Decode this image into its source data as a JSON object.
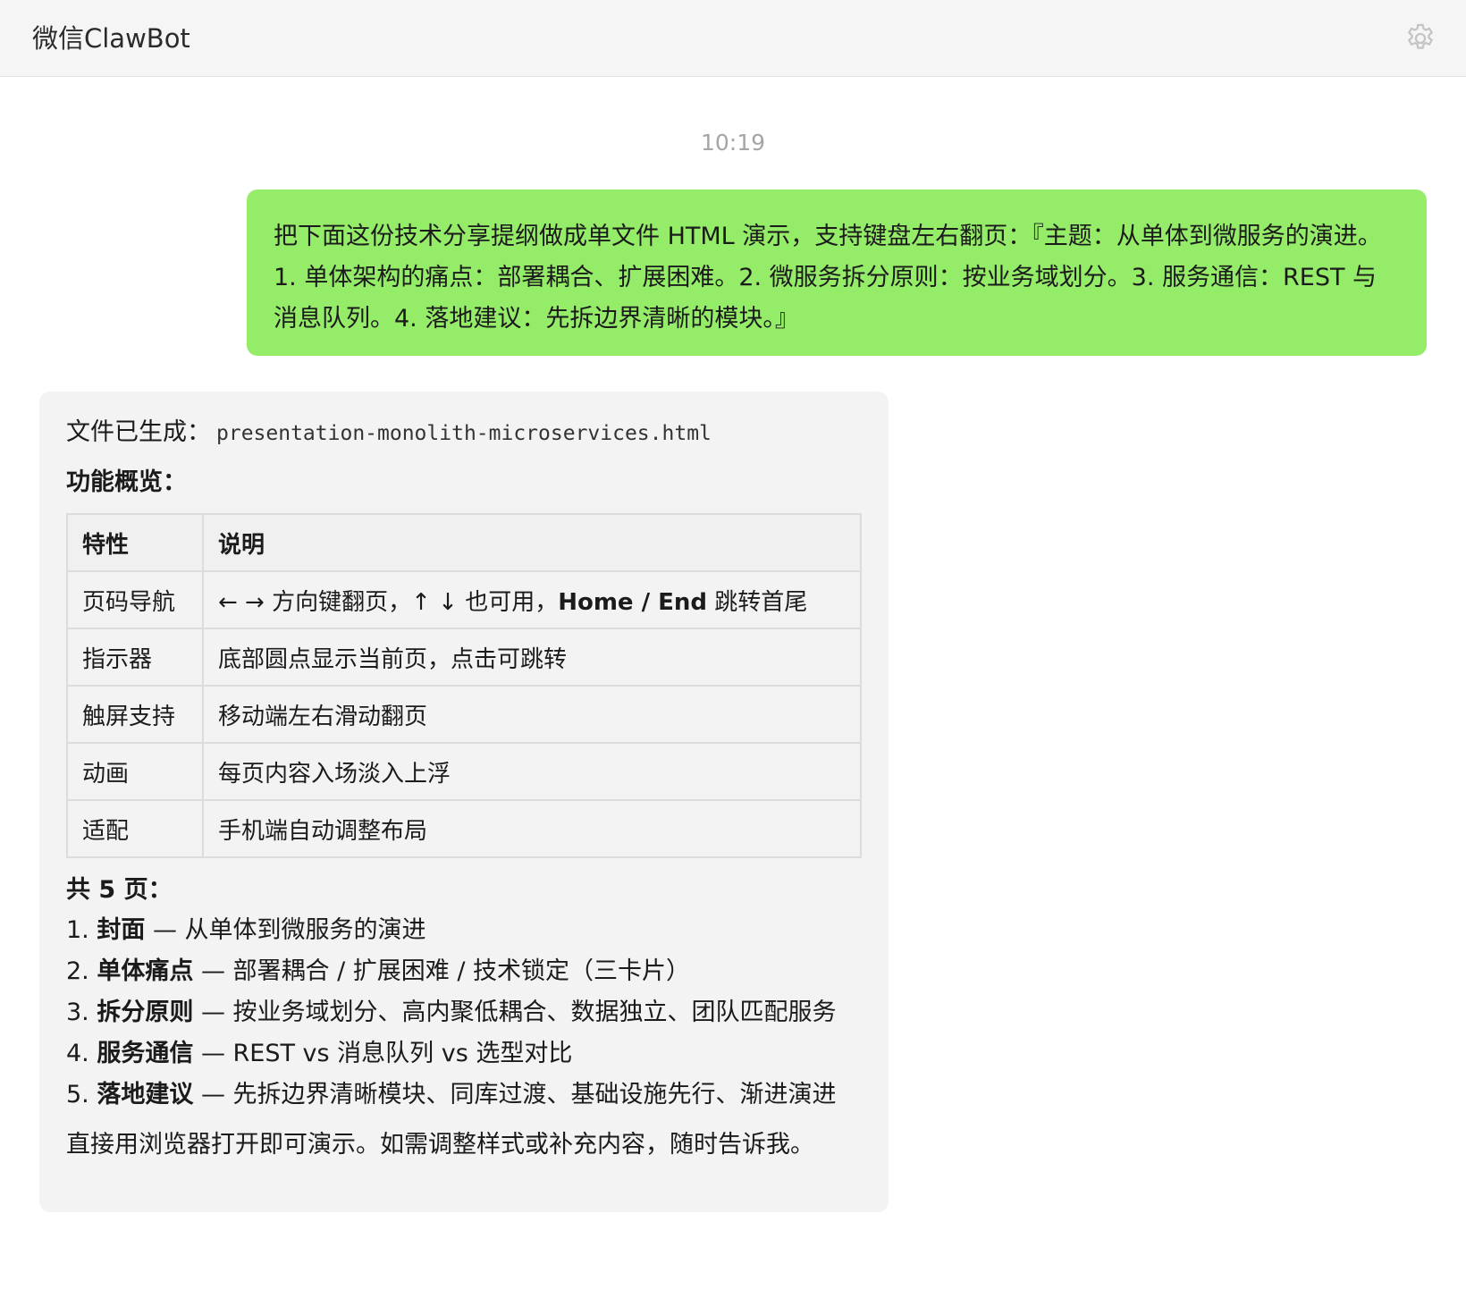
{
  "header": {
    "title": "微信ClawBot",
    "settings_icon": "gear-icon"
  },
  "chat": {
    "timestamp": "10:19",
    "user_message": "把下面这份技术分享提纲做成单文件 HTML 演示，支持键盘左右翻页：『主题：从单体到微服务的演进。1. 单体架构的痛点：部署耦合、扩展困难。2. 微服务拆分原则：按业务域划分。3. 服务通信：REST 与消息队列。4. 落地建议：先拆边界清晰的模块。』",
    "bot": {
      "file_label": "文件已生成：",
      "file_name": "presentation-monolith-microservices.html",
      "overview_heading": "功能概览：",
      "table": {
        "headers": [
          "特性",
          "说明"
        ],
        "rows": [
          {
            "feature": "页码导航",
            "desc_pre": "← → 方向键翻页，↑ ↓ 也可用，",
            "desc_bold": "Home / End",
            "desc_post": " 跳转首尾"
          },
          {
            "feature": "指示器",
            "desc_pre": "底部圆点显示当前页，点击可跳转",
            "desc_bold": "",
            "desc_post": ""
          },
          {
            "feature": "触屏支持",
            "desc_pre": "移动端左右滑动翻页",
            "desc_bold": "",
            "desc_post": ""
          },
          {
            "feature": "动画",
            "desc_pre": "每页内容入场淡入上浮",
            "desc_bold": "",
            "desc_post": ""
          },
          {
            "feature": "适配",
            "desc_pre": "手机端自动调整布局",
            "desc_bold": "",
            "desc_post": ""
          }
        ]
      },
      "pages_heading": "共 5 页：",
      "pages": [
        {
          "num": "1.",
          "name": "封面",
          "desc": " — 从单体到微服务的演进"
        },
        {
          "num": "2.",
          "name": "单体痛点",
          "desc": " — 部署耦合 / 扩展困难 / 技术锁定（三卡片）"
        },
        {
          "num": "3.",
          "name": "拆分原则",
          "desc": " — 按业务域划分、高内聚低耦合、数据独立、团队匹配服务"
        },
        {
          "num": "4.",
          "name": "服务通信",
          "desc": " — REST vs 消息队列 vs 选型对比"
        },
        {
          "num": "5.",
          "name": "落地建议",
          "desc": " — 先拆边界清晰模块、同库过渡、基础设施先行、渐进演进"
        }
      ],
      "closing": "直接用浏览器打开即可演示。如需调整样式或补充内容，随时告诉我。"
    }
  },
  "colors": {
    "header_bg": "#f5f5f5",
    "user_bubble": "#95ec69",
    "bot_bubble": "#f3f3f3",
    "timestamp": "#a5a5a5"
  }
}
